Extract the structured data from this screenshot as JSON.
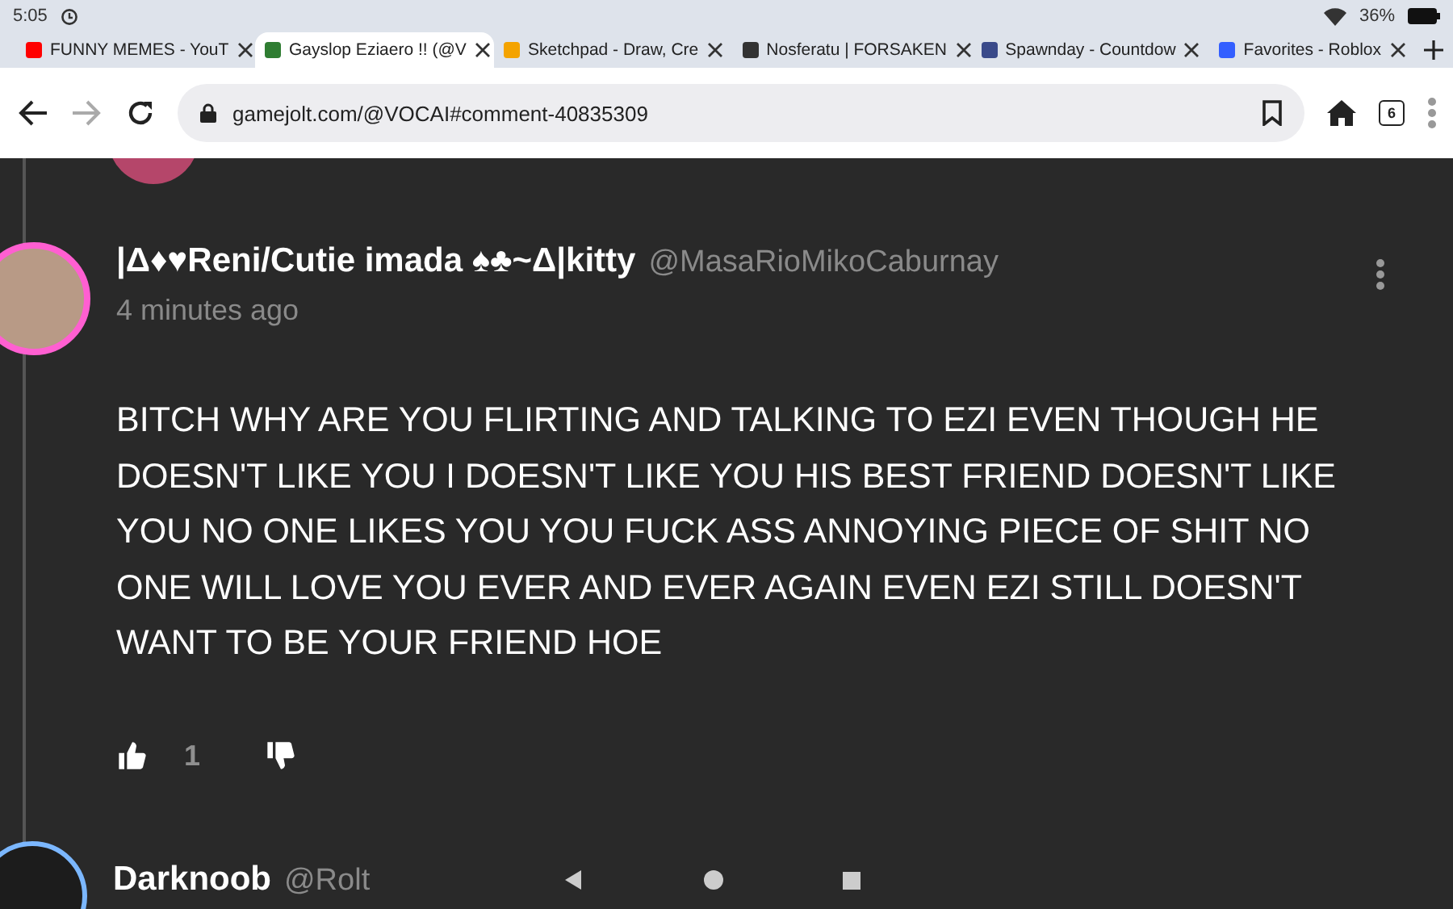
{
  "status_bar": {
    "time": "5:05",
    "battery": "36%"
  },
  "tabs": [
    {
      "title": "FUNNY MEMES - YouT",
      "selected": false,
      "color": "#ff0000"
    },
    {
      "title": "Gayslop Eziaero !! (@V",
      "selected": true,
      "color": "#2f7d32"
    },
    {
      "title": "Sketchpad - Draw, Cre",
      "selected": false,
      "color": "#f4a300"
    },
    {
      "title": "Nosferatu | FORSAKEN",
      "selected": false,
      "color": "#333333"
    },
    {
      "title": "Spawnday - Countdow",
      "selected": false,
      "color": "#3a4a8a"
    },
    {
      "title": "Favorites - Roblox",
      "selected": false,
      "color": "#335fff"
    }
  ],
  "address_bar": {
    "url": "gamejolt.com/@VOCAI#comment-40835309",
    "tab_count": "6"
  },
  "comments": [
    {
      "name": "|Δ♦♥Reni/Cutie imada ♠♣~Δ|kitty",
      "handle": "@MasaRioMikoCaburnay",
      "time": "4 minutes ago",
      "body": "BITCH WHY ARE YOU FLIRTING AND TALKING TO EZI EVEN THOUGH HE DOESN'T LIKE YOU I DOESN'T LIKE YOU HIS BEST FRIEND DOESN'T LIKE YOU NO ONE LIKES YOU YOU FUCK ASS ANNOYING PIECE OF SHIT NO ONE WILL LOVE YOU EVER AND EVER AGAIN EVEN EZI STILL DOESN'T WANT TO BE YOUR FRIEND HOE",
      "likes": "1"
    },
    {
      "name": "Darknoob",
      "handle": "@Rolt"
    }
  ]
}
